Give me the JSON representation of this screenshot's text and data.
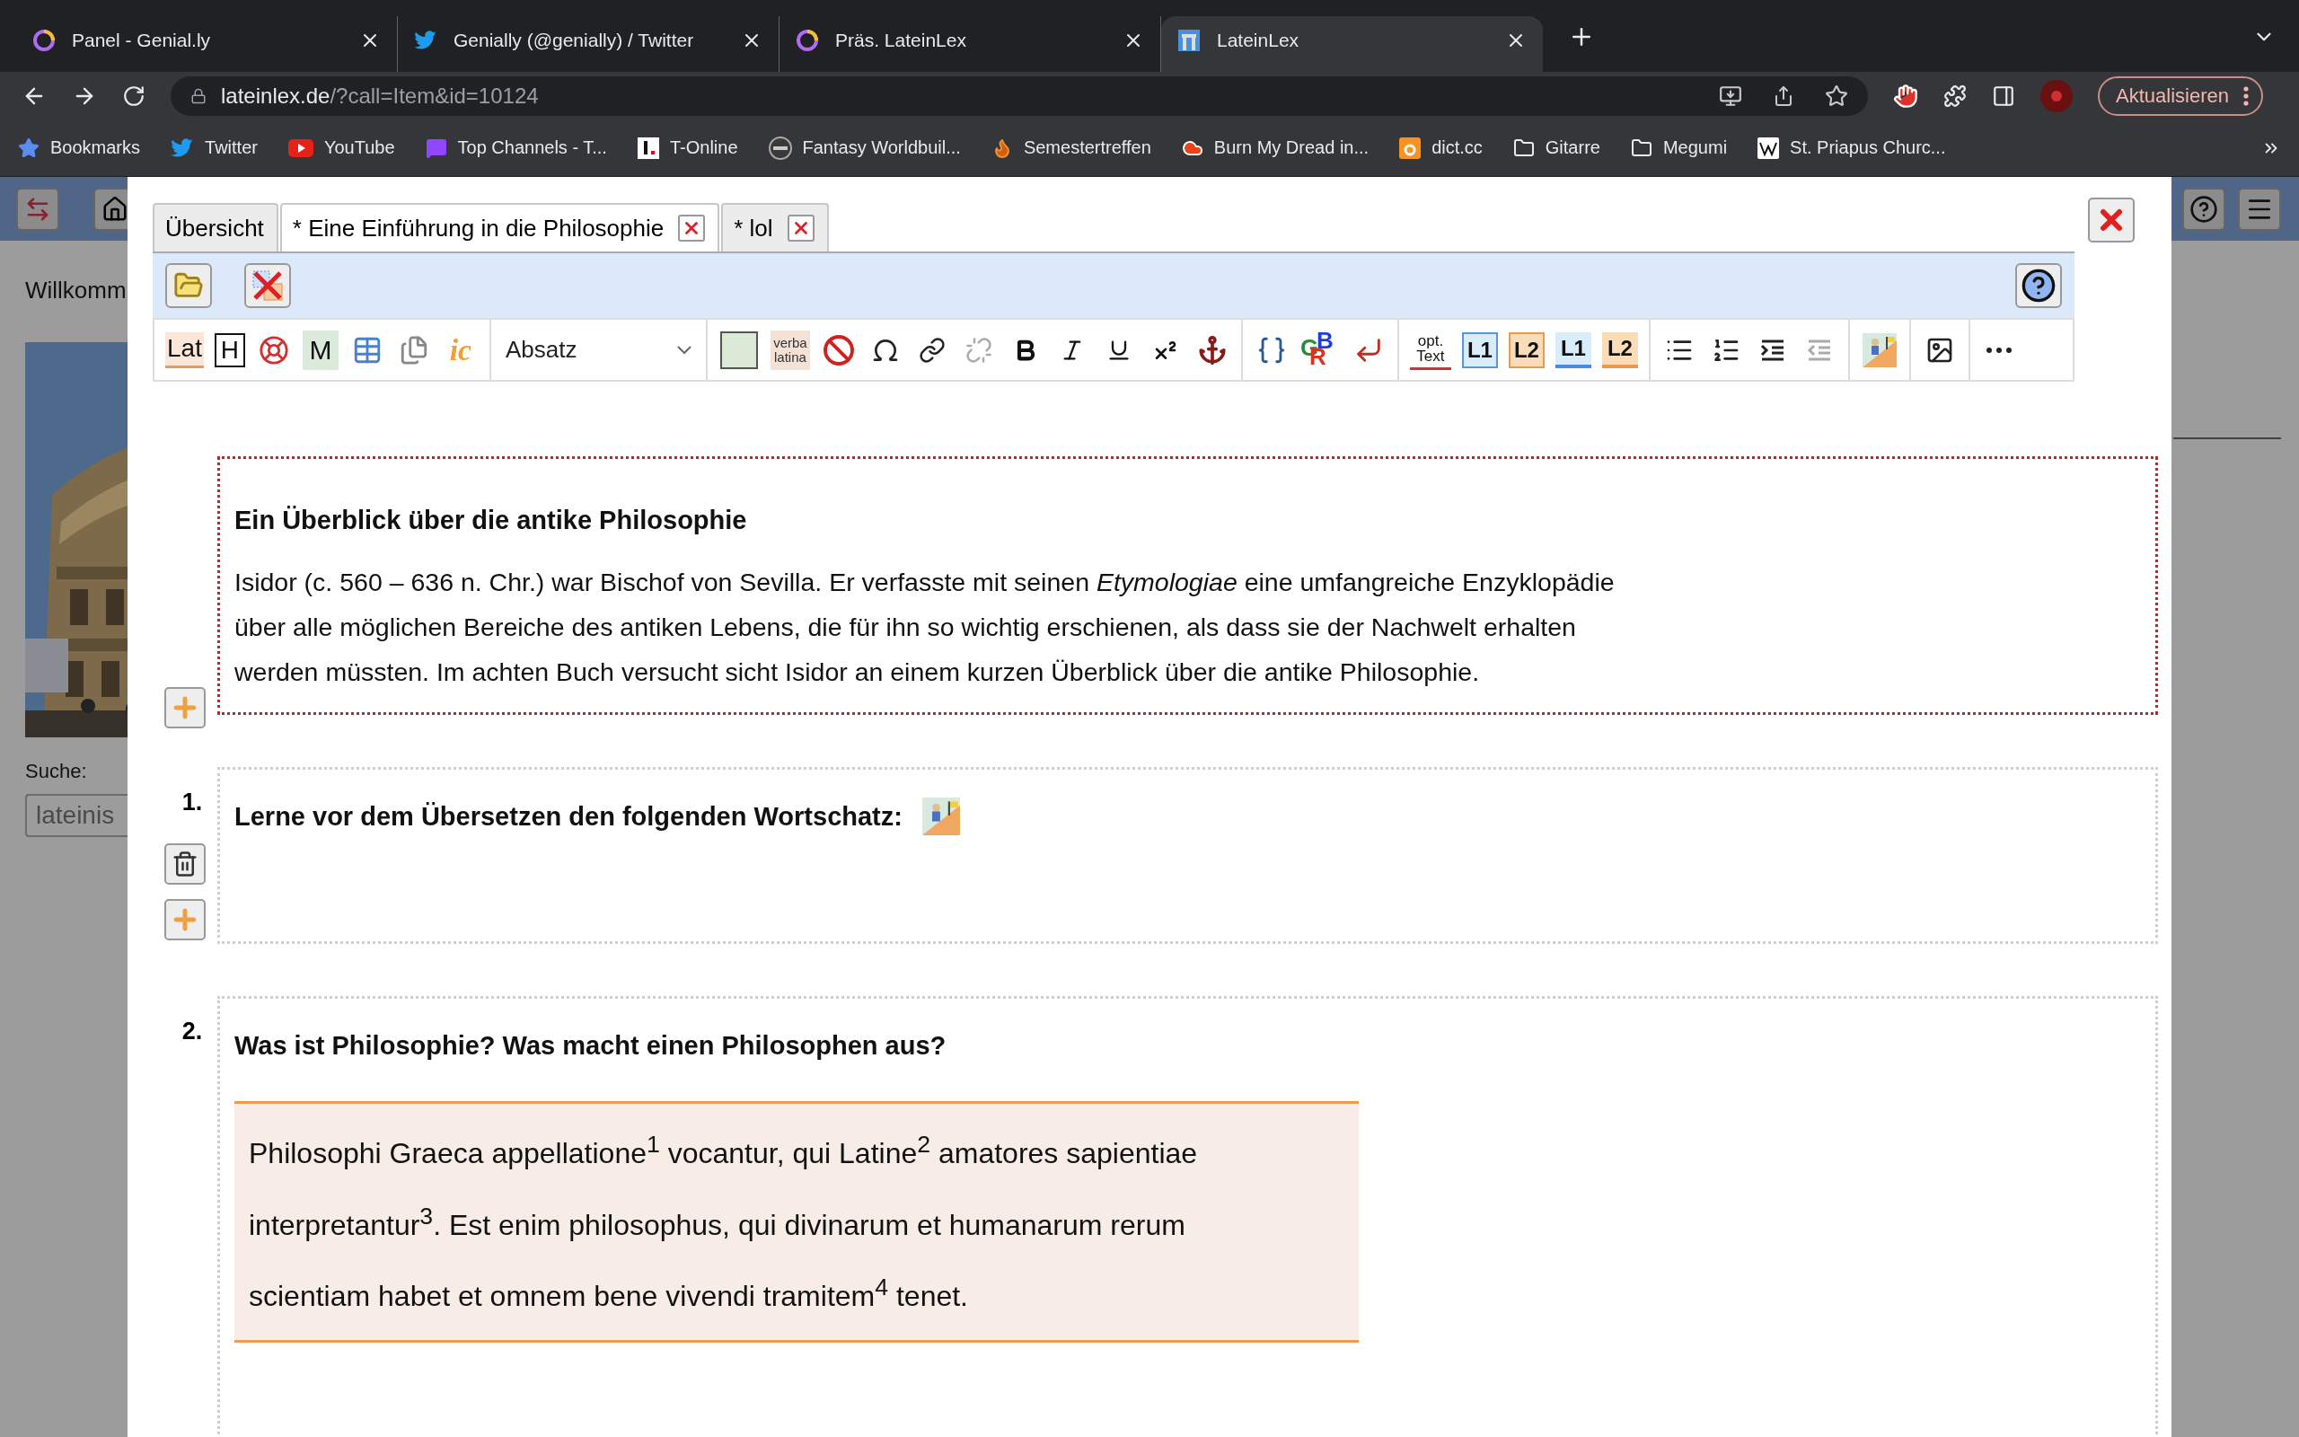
{
  "browser": {
    "tabs": [
      {
        "title": "Panel - Genial.ly",
        "kind": "ring",
        "selected": false
      },
      {
        "title": "Genially (@genially) / Twitter",
        "kind": "bird",
        "selected": false
      },
      {
        "title": "Präs. LateinLex",
        "kind": "ring",
        "selected": false
      },
      {
        "title": "LateinLex",
        "kind": "site",
        "selected": true
      }
    ],
    "address": {
      "host": "lateinlex.de",
      "path": "/?call=Item&id=10124"
    },
    "update_button": "Aktualisieren",
    "bookmarks": [
      {
        "label": "Bookmarks",
        "kind": "star"
      },
      {
        "label": "Twitter",
        "kind": "bird"
      },
      {
        "label": "YouTube",
        "kind": "play"
      },
      {
        "label": "Top Channels - T...",
        "kind": "chat"
      },
      {
        "label": "T-Online",
        "kind": "square"
      },
      {
        "label": "Fantasy Worldbuil...",
        "kind": "badge"
      },
      {
        "label": "Semestertreffen",
        "kind": "flame"
      },
      {
        "label": "Burn My Dread in...",
        "kind": "cloud"
      },
      {
        "label": "dict.cc",
        "kind": "tile"
      },
      {
        "label": "Gitarre",
        "kind": "folder"
      },
      {
        "label": "Megumi",
        "kind": "folder"
      },
      {
        "label": "St. Priapus Churc...",
        "kind": "wiki"
      }
    ]
  },
  "sidebar": {
    "welcome": "Willkomm",
    "search_label": "Suche:",
    "search_value": "lateinis"
  },
  "editor_tabs": [
    {
      "label": "Übersicht",
      "selected": false,
      "closable": false
    },
    {
      "label": "* Eine Einführung in die Philosophie",
      "selected": true,
      "closable": true
    },
    {
      "label": "* lol",
      "selected": false,
      "closable": true
    }
  ],
  "format_toolbar": {
    "lat": "Lat",
    "heading": "H",
    "m": "M",
    "ic": "ic",
    "block_format": "Absatz",
    "verba": "verba latina",
    "gbr": [
      "G",
      "B",
      "R"
    ],
    "opt": "opt. Text",
    "levels": [
      "L1",
      "L2",
      "L1",
      "L2"
    ]
  },
  "blocks": [
    {
      "kind": "text",
      "title": "Ein Überblick über die antike Philosophie",
      "paragraph": "Isidor (c. 560 – 636 n. Chr.) war Bischof von Sevilla. Er verfasste mit seinen *Etymologiae* eine umfangreiche Enzyklopädie über alle möglichen Bereiche des antiken Lebens, die für ihn so wichtig erschienen, als dass sie der Nachwelt erhalten werden müssten. Im achten Buch versucht sicht Isidor an einem kurzen Überblick über die antike Philosophie."
    },
    {
      "kind": "vocab",
      "number": "1.",
      "title": "Lerne vor dem Übersetzen den folgenden Wortschatz:"
    },
    {
      "kind": "translation",
      "number": "2.",
      "title": "Was ist Philosophie? Was macht einen Philosophen aus?",
      "latin": "Philosophi Graeca appellatione$^{1}$ vocantur, qui Latine$^{2}$ amatores sapientiae interpretantur$^{3}$. Est enim philosophus, qui divinarum et humanarum rerum scientiam habet et omnem bene vivendi tramitem$^{4}$ tenet."
    }
  ]
}
